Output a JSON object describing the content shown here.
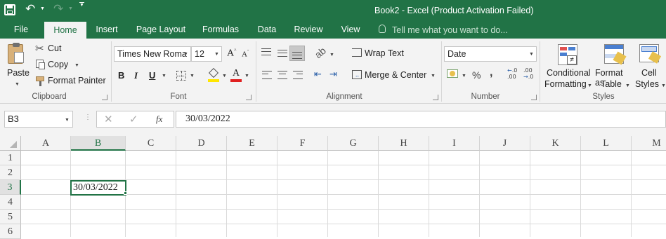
{
  "title": "Book2 - Excel (Product Activation Failed)",
  "tabs": [
    "File",
    "Home",
    "Insert",
    "Page Layout",
    "Formulas",
    "Data",
    "Review",
    "View"
  ],
  "tell_me": "Tell me what you want to do...",
  "clipboard": {
    "paste": "Paste",
    "cut": "Cut",
    "copy": "Copy",
    "format_painter": "Format Painter",
    "label": "Clipboard"
  },
  "font": {
    "name": "Times New Roma",
    "size": "12",
    "bold": "B",
    "italic": "I",
    "underline": "U",
    "label": "Font"
  },
  "alignment": {
    "wrap": "Wrap Text",
    "merge": "Merge & Center",
    "label": "Alignment"
  },
  "number": {
    "format": "Date",
    "percent": "%",
    "comma": ",",
    "label": "Number"
  },
  "styles": {
    "cond1": "Conditional",
    "cond2": "Formatting",
    "fmt1": "Format as",
    "fmt2": "Table",
    "cell1": "Cell",
    "cell2": "Styles",
    "label": "Styles"
  },
  "formula_bar": {
    "name_box": "B3",
    "fx": "fx",
    "value": "30/03/2022"
  },
  "columns": [
    "A",
    "B",
    "C",
    "D",
    "E",
    "F",
    "G",
    "H",
    "I",
    "J",
    "K",
    "L",
    "M"
  ],
  "rows": [
    "1",
    "2",
    "3",
    "4",
    "5",
    "6"
  ],
  "cells": {
    "B3": "30/03/2022"
  },
  "colors": {
    "excel_green": "#217346",
    "font_color_red": "#e02020",
    "highlight_yellow": "#ffe600"
  }
}
